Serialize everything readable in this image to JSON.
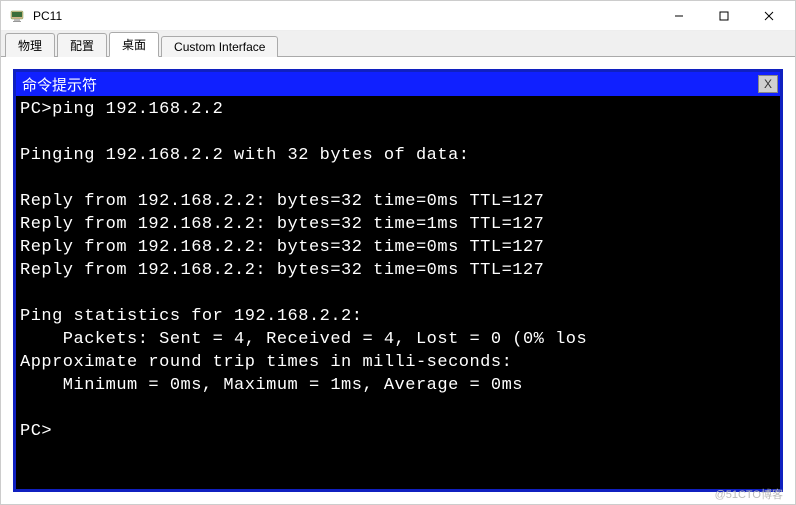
{
  "window": {
    "title": "PC11"
  },
  "tabs": {
    "items": [
      {
        "label": "物理"
      },
      {
        "label": "配置"
      },
      {
        "label": "桌面"
      },
      {
        "label": "Custom Interface"
      }
    ],
    "active_index": 2
  },
  "terminal": {
    "title": "命令提示符",
    "close_label": "X",
    "lines": [
      "PC>ping 192.168.2.2",
      "",
      "Pinging 192.168.2.2 with 32 bytes of data:",
      "",
      "Reply from 192.168.2.2: bytes=32 time=0ms TTL=127",
      "Reply from 192.168.2.2: bytes=32 time=1ms TTL=127",
      "Reply from 192.168.2.2: bytes=32 time=0ms TTL=127",
      "Reply from 192.168.2.2: bytes=32 time=0ms TTL=127",
      "",
      "Ping statistics for 192.168.2.2:",
      "    Packets: Sent = 4, Received = 4, Lost = 0 (0% los",
      "Approximate round trip times in milli-seconds:",
      "    Minimum = 0ms, Maximum = 1ms, Average = 0ms",
      "",
      "PC>"
    ]
  },
  "watermark": "@51CTO博客"
}
